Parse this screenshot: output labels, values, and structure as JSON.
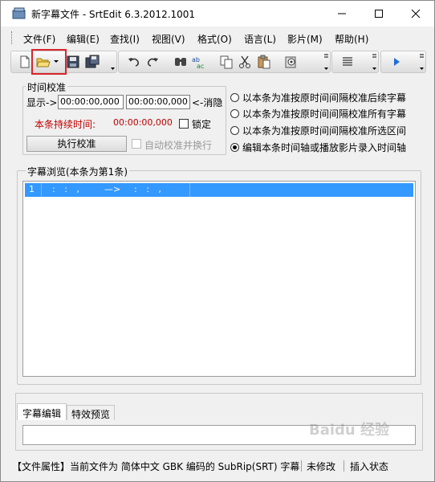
{
  "window": {
    "title": "新字幕文件 - SrtEdit 6.3.2012.1001"
  },
  "menu": [
    "文件(F)",
    "编辑(E)",
    "查找(I)",
    "视图(V)",
    "格式(O)",
    "语言(L)",
    "影片(M)",
    "帮助(H)"
  ],
  "time_calibration": {
    "legend": "时间校准",
    "show_label": "显示->",
    "start_time": "00:00:00,000",
    "end_time": "00:00:00,000",
    "clear_label": "<-消隐",
    "duration_label": "本条持续时间:",
    "duration_value": "00:00:00,000",
    "lock_label": "锁定",
    "execute_label": "执行校准",
    "auto_label": "自动校准并换行"
  },
  "radio_options": [
    "以本条为准按原时间间隔校准后续字幕",
    "以本条为准按原时间间隔校准所有字幕",
    "以本条为准按原时间间隔校准所选区间",
    "编辑本条时间轴或播放影片录入时间轴"
  ],
  "browse": {
    "legend": "字幕浏览(本条为第1条)",
    "row": {
      "index": "1",
      "start": ": : ,",
      "arrow": "—>",
      "end": ": : ,"
    }
  },
  "tabs": [
    "字幕编辑",
    "特效预览"
  ],
  "status": {
    "file_info": "【文件属性】当前文件为 简体中文 GBK 编码的 SubRip(SRT) 字幕",
    "modified": "未修改",
    "mode": "插入状态"
  },
  "watermark": "Baidu 经验",
  "colors": {
    "selection": "#3399ff",
    "duration_label": "#c00000",
    "highlight": "#d9262b"
  }
}
